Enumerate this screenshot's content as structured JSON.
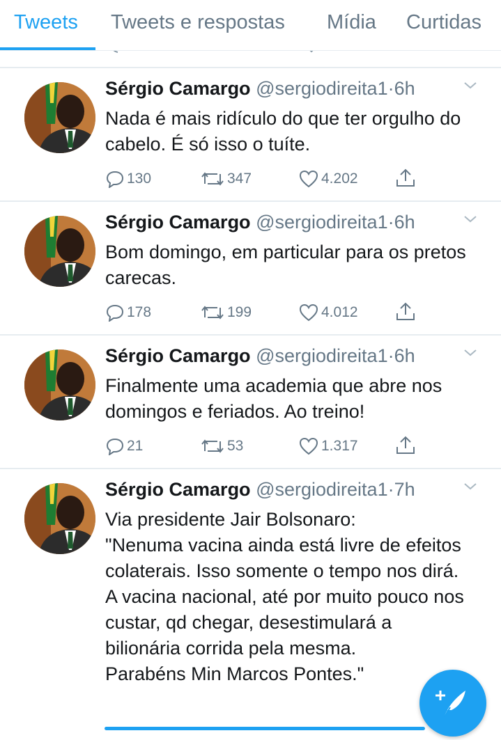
{
  "tabs": [
    {
      "label": "Tweets",
      "active": true
    },
    {
      "label": "Tweets e respostas",
      "active": false
    },
    {
      "label": "Mídia",
      "active": false
    },
    {
      "label": "Curtidas",
      "active": false
    }
  ],
  "accent_color": "#1da1f2",
  "tweets": [
    {
      "name": "Sérgio Camargo",
      "handle": "@sergiodireita1",
      "dot": "·",
      "time": "6h",
      "text": "Nada é mais ridículo do que ter orgulho do cabelo. É só isso o tuíte.",
      "replies": "130",
      "retweets": "347",
      "likes": "4.202"
    },
    {
      "name": "Sérgio Camargo",
      "handle": "@sergiodireita1",
      "dot": "·",
      "time": "6h",
      "text": "Bom domingo, em particular para os pretos carecas.",
      "replies": "178",
      "retweets": "199",
      "likes": "4.012"
    },
    {
      "name": "Sérgio Camargo",
      "handle": "@sergiodireita1",
      "dot": "·",
      "time": "6h",
      "text": "Finalmente uma academia que abre nos domingos e feriados. Ao treino!",
      "replies": "21",
      "retweets": "53",
      "likes": "1.317"
    },
    {
      "name": "Sérgio Camargo",
      "handle": "@sergiodireita1",
      "dot": "·",
      "time": "7h",
      "text": "Via presidente Jair Bolsonaro:\n\"Nenuma vacina ainda está livre de efeitos colaterais. Isso somente o tempo nos dirá.\nA vacina nacional, até por muito pouco nos custar, qd chegar, desestimulará a bilionária corrida pela mesma.\nParabéns Min Marcos Pontes.\""
    }
  ],
  "icons": {
    "reply": "reply-icon",
    "retweet": "retweet-icon",
    "like": "heart-icon",
    "share": "share-icon",
    "more": "chevron-down-icon",
    "compose": "compose-tweet-icon"
  }
}
